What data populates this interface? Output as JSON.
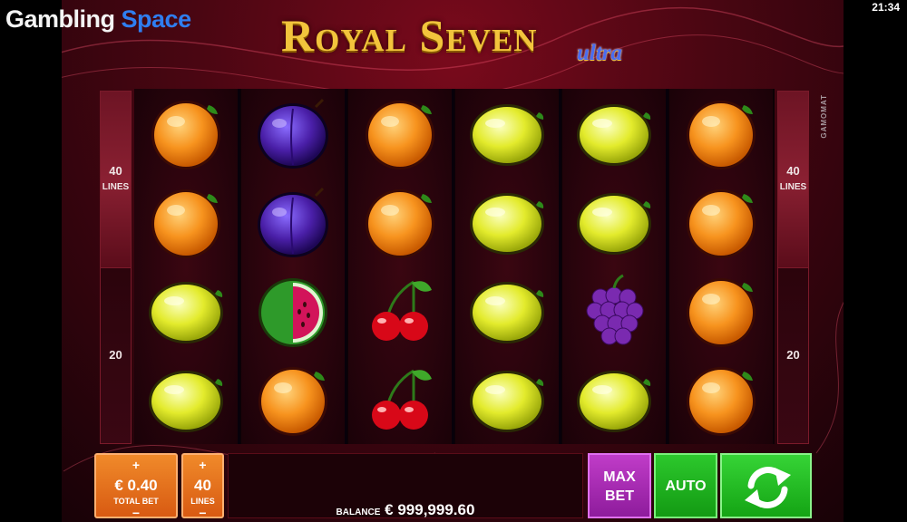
{
  "brand": {
    "part1": "Gambling",
    "part2": "Space"
  },
  "status": {
    "clock": "21:34"
  },
  "game": {
    "title": "Royal Seven",
    "subtitle": "ultra",
    "provider": "GAMOMAT"
  },
  "lines_panel": {
    "left_upper_value": "40",
    "left_upper_label": "LINES",
    "left_lower_value": "20",
    "right_upper_value": "40",
    "right_upper_label": "LINES",
    "right_lower_value": "20"
  },
  "reels": [
    [
      "orange",
      "orange",
      "lemon",
      "lemon"
    ],
    [
      "plum",
      "plum",
      "melon",
      "orange"
    ],
    [
      "orange",
      "orange",
      "cherry",
      "cherry"
    ],
    [
      "lemon",
      "lemon",
      "lemon",
      "lemon"
    ],
    [
      "lemon",
      "lemon",
      "grapes",
      "lemon"
    ],
    [
      "orange",
      "orange",
      "orange",
      "orange"
    ]
  ],
  "controls": {
    "bet": {
      "plus": "+",
      "value": "€ 0.40",
      "label": "TOTAL BET",
      "minus": "−"
    },
    "lines": {
      "plus": "+",
      "value": "40",
      "label": "LINES",
      "minus": "−"
    },
    "balance_label": "BALANCE",
    "balance_value": "€ 999,999.60",
    "max_bet_line1": "MAX",
    "max_bet_line2": "BET",
    "auto_label": "AUTO",
    "spin_icon": "refresh-arrows-icon"
  },
  "colors": {
    "orange_btn": "#e8741c",
    "max_btn": "#a82ab4",
    "auto_btn": "#20b020",
    "spin_btn": "#28c028",
    "title_gold": "#f2c43c",
    "ultra_blue": "#4a6cf0"
  }
}
